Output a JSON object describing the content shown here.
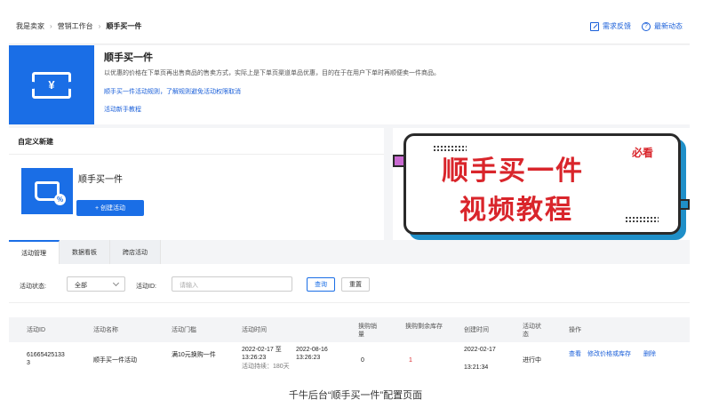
{
  "breadcrumb": [
    "我是卖家",
    "营销工作台",
    "顺手买一件"
  ],
  "top_links": {
    "feedback": "需求反馈",
    "news": "最新动态"
  },
  "intro": {
    "logo_symbol": "¥",
    "title": "顺手买一件",
    "description": "以优惠的价格在下单页再出售商品的售卖方式，实际上是下单页渠道单品优惠，目的在于在用户下单时再顺便卖一件商品。",
    "link_rules": "顺手买一件活动规则，了解规则避免活动权限取消",
    "link_tutorial": "活动新手教程"
  },
  "custom_panel": {
    "heading": "自定义新建",
    "item_name": "顺手买一件",
    "create_button": "+ 创建活动"
  },
  "banner": {
    "line1": "顺手买一件",
    "line2": "视频教程",
    "tag": "必看",
    "colors": {
      "text": "#d9252b",
      "shadow": "#1f8fc8",
      "accent": "#c96ad1"
    }
  },
  "tabs": [
    "活动管理",
    "数据看板",
    "跨店活动"
  ],
  "filter": {
    "status_label": "活动状态:",
    "status_value": "全部",
    "id_label": "活动ID:",
    "id_placeholder": "请输入",
    "query_button": "查询",
    "reset_button": "重置"
  },
  "table": {
    "headers": [
      "活动ID",
      "活动名称",
      "活动门槛",
      "活动时间",
      "换购销量",
      "换购剩余库存",
      "创建时间",
      "活动状态",
      "操作"
    ],
    "row": {
      "id": "616654251333",
      "name": "顺手买一件活动",
      "threshold": "满10元换购一件",
      "time_start": "2022-02-17 至",
      "time_start_clock": "13:26:23",
      "time_end": "2022-08-16",
      "time_end_clock": "13:26:23",
      "duration": "活动持续：180天",
      "sales": "0",
      "stock": "1",
      "created": "2022-02-17",
      "created_clock": "13:21:34",
      "status": "进行中",
      "actions": {
        "view": "查看",
        "edit": "修改价格或库存",
        "delete": "删除"
      }
    }
  },
  "caption": "千牛后台“顺手买一件”配置页面",
  "accent_color": "#1a6ee6"
}
